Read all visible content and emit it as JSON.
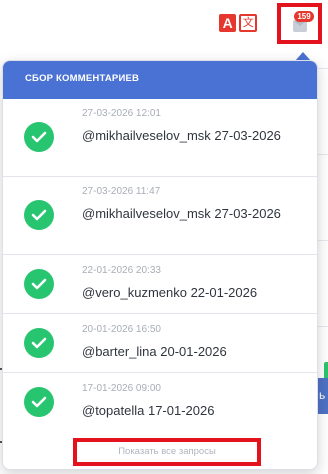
{
  "toolbar": {
    "translate_glyph_a": "A",
    "translate_glyph_b": "文",
    "notification_count": "159"
  },
  "panel": {
    "title": "СБОР КОММЕНТАРИЕВ",
    "items": [
      {
        "date": "27-03-2026 12:01",
        "text": "@mikhailveselov_msk 27-03-2026"
      },
      {
        "date": "27-03-2026 11:47",
        "text": "@mikhailveselov_msk 27-03-2026"
      },
      {
        "date": "22-01-2026 20:33",
        "text": "@vero_kuzmenko 22-01-2026"
      },
      {
        "date": "20-01-2026 16:50",
        "text": "@barter_lina 20-01-2026"
      },
      {
        "date": "17-01-2026 09:00",
        "text": "@topatella 17-01-2026"
      }
    ],
    "show_all_label": "Показать все запросы"
  },
  "colors": {
    "header": "#4a72d4",
    "success": "#27c56f",
    "highlight": "#e4121c"
  },
  "background": {
    "right_edge_glyph": "ь"
  }
}
